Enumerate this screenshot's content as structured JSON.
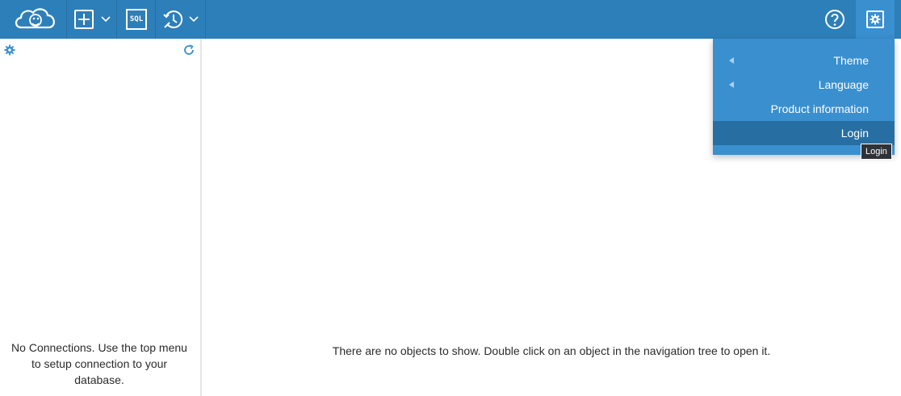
{
  "toolbar": {
    "logo_icon": "cloudbeaver-logo",
    "new_connection_icon": "plus-square-icon",
    "sql_label": "SQL",
    "history_icon": "transaction-history-icon",
    "help_icon": "question-circle-icon",
    "settings_icon": "gear-icon"
  },
  "navigator": {
    "settings_icon": "gear-icon",
    "refresh_icon": "refresh-icon",
    "empty_text": "No Connections. Use the top menu to setup connection to your database."
  },
  "main": {
    "empty_text": "There are no objects to show. Double click on an object in the navigation tree to open it."
  },
  "settings_menu": {
    "items": [
      {
        "label": "Theme",
        "has_submenu": true
      },
      {
        "label": "Language",
        "has_submenu": true
      },
      {
        "label": "Product information",
        "has_submenu": false
      },
      {
        "label": "Login",
        "has_submenu": false,
        "hovered": true
      }
    ],
    "tooltip": "Login"
  },
  "colors": {
    "topbar": "#2d7fb9",
    "menu": "#3a8fcf",
    "menu_hover": "#276fa3",
    "accent_icon": "#3a8fcf"
  }
}
